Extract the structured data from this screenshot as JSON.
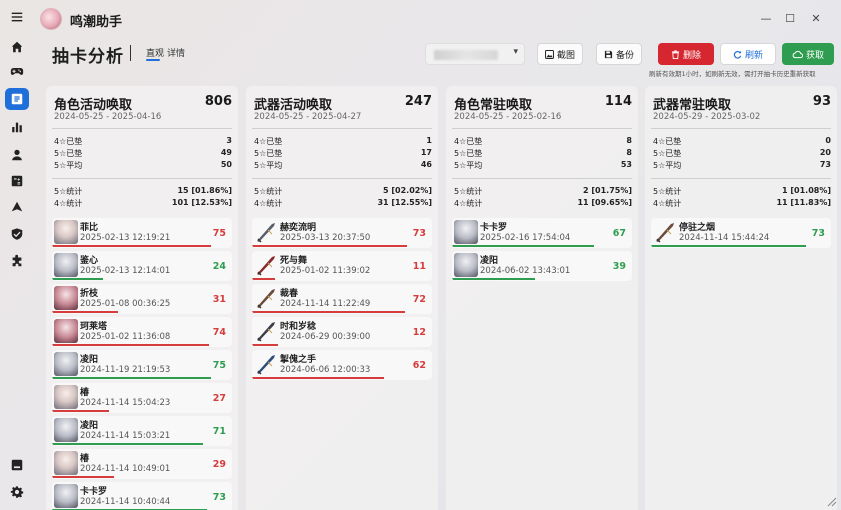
{
  "app": {
    "title": "鸣潮助手",
    "window_controls": [
      "—",
      "☐",
      "✕"
    ]
  },
  "rail": {
    "top_items": [
      "menu-icon",
      "home-icon",
      "gamepad-icon",
      "card-icon",
      "bar-chart-icon",
      "user-icon",
      "calculator-icon",
      "up-arrow-icon",
      "shield-check-icon",
      "puzzle-icon"
    ],
    "bottom_items": [
      "book-icon",
      "settings-icon"
    ],
    "active": "card-icon"
  },
  "header": {
    "title": "抽卡分析",
    "tabs": [
      {
        "label": "直观",
        "active": true
      },
      {
        "label": "详情",
        "active": false
      }
    ],
    "account_caret": "▾",
    "buttons": {
      "screenshot": "截图",
      "backup": "备份",
      "delete": "删除",
      "refresh": "刷新",
      "fetch": "获取"
    },
    "hint": "刷新有效期1小时，如刷新无效，需打开抽卡历史重新获取"
  },
  "colors": {
    "accent": "#1e6fd9",
    "red": "#d6262f",
    "green": "#2e9d4f",
    "count_red": "#d63c3c",
    "count_green": "#2e9d4f"
  },
  "columns": [
    {
      "title": "角色活动唤取",
      "total": "806",
      "range": "2024-05-25 - 2025-04-16",
      "stats": [
        [
          "4☆已垫",
          "3"
        ],
        [
          "5☆已垫",
          "49"
        ],
        [
          "5☆平均",
          "50"
        ]
      ],
      "stats2": [
        [
          "5☆统计",
          "15 [01.86%]"
        ],
        [
          "4☆统计",
          "101 [12.53%]"
        ]
      ],
      "items": [
        {
          "name": "菲比",
          "time": "2025-02-13 12:19:21",
          "count": "75",
          "good": false,
          "thumb": "char"
        },
        {
          "name": "鉴心",
          "time": "2025-02-13 12:14:01",
          "count": "24",
          "good": true,
          "thumb": "char2"
        },
        {
          "name": "折枝",
          "time": "2025-01-08 00:36:25",
          "count": "31",
          "good": false,
          "thumb": "char3"
        },
        {
          "name": "珂莱塔",
          "time": "2025-01-02 11:36:08",
          "count": "74",
          "good": false,
          "thumb": "char3"
        },
        {
          "name": "凌阳",
          "time": "2024-11-19 21:19:53",
          "count": "75",
          "good": true,
          "thumb": "char2"
        },
        {
          "name": "椿",
          "time": "2024-11-14 15:04:23",
          "count": "27",
          "good": false,
          "thumb": "char"
        },
        {
          "name": "凌阳",
          "time": "2024-11-14 15:03:21",
          "count": "71",
          "good": true,
          "thumb": "char2"
        },
        {
          "name": "椿",
          "time": "2024-11-14 10:49:01",
          "count": "29",
          "good": false,
          "thumb": "char"
        },
        {
          "name": "卡卡罗",
          "time": "2024-11-14 10:40:44",
          "count": "73",
          "good": true,
          "thumb": "char2"
        }
      ]
    },
    {
      "title": "武器活动唤取",
      "total": "247",
      "range": "2024-05-25 - 2025-04-27",
      "stats": [
        [
          "4☆已垫",
          "1"
        ],
        [
          "5☆已垫",
          "17"
        ],
        [
          "5☆平均",
          "46"
        ]
      ],
      "stats2": [
        [
          "5☆统计",
          "5 [02.02%]"
        ],
        [
          "4☆统计",
          "31 [12.55%]"
        ]
      ],
      "items": [
        {
          "name": "赫奕流明",
          "time": "2025-03-13 20:37:50",
          "count": "73",
          "good": false,
          "thumb": "weap"
        },
        {
          "name": "死与舞",
          "time": "2025-01-02 11:39:02",
          "count": "11",
          "good": false,
          "thumb": "weap"
        },
        {
          "name": "裁春",
          "time": "2024-11-14 11:22:49",
          "count": "72",
          "good": false,
          "thumb": "weap"
        },
        {
          "name": "时和岁稔",
          "time": "2024-06-29 00:39:00",
          "count": "12",
          "good": false,
          "thumb": "weap"
        },
        {
          "name": "掣傀之手",
          "time": "2024-06-06 12:00:33",
          "count": "62",
          "good": false,
          "thumb": "weap"
        }
      ]
    },
    {
      "title": "角色常驻唤取",
      "total": "114",
      "range": "2024-05-25 - 2025-02-16",
      "stats": [
        [
          "4☆已垫",
          "8"
        ],
        [
          "5☆已垫",
          "8"
        ],
        [
          "5☆平均",
          "53"
        ]
      ],
      "stats2": [
        [
          "5☆统计",
          "2 [01.75%]"
        ],
        [
          "4☆统计",
          "11 [09.65%]"
        ]
      ],
      "items": [
        {
          "name": "卡卡罗",
          "time": "2025-02-16 17:54:04",
          "count": "67",
          "good": true,
          "thumb": "char2"
        },
        {
          "name": "凌阳",
          "time": "2024-06-02 13:43:01",
          "count": "39",
          "good": true,
          "thumb": "char2"
        }
      ]
    },
    {
      "title": "武器常驻唤取",
      "total": "93",
      "range": "2024-05-29 - 2025-03-02",
      "stats": [
        [
          "4☆已垫",
          "0"
        ],
        [
          "5☆已垫",
          "20"
        ],
        [
          "5☆平均",
          "73"
        ]
      ],
      "stats2": [
        [
          "5☆统计",
          "1 [01.08%]"
        ],
        [
          "4☆统计",
          "11 [11.83%]"
        ]
      ],
      "items": [
        {
          "name": "停驻之烟",
          "time": "2024-11-14 15:44:24",
          "count": "73",
          "good": true,
          "thumb": "weap"
        }
      ]
    }
  ]
}
